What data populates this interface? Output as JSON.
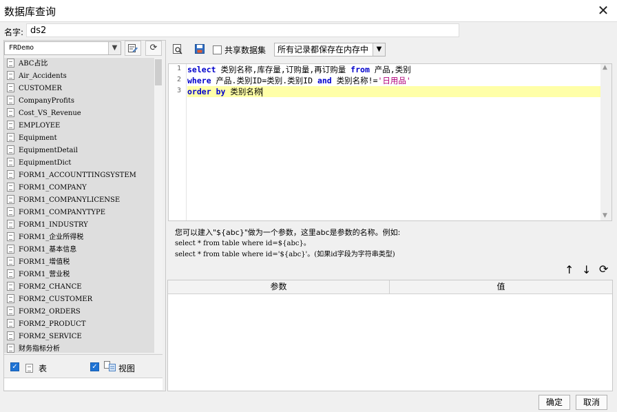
{
  "window": {
    "title": "数据库查询",
    "close_label": "✕"
  },
  "name_field": {
    "label": "名字:",
    "value": "ds2"
  },
  "left": {
    "datasource": "FRDemo",
    "tables": [
      "ABC占比",
      "Air_Accidents",
      "CUSTOMER",
      "CompanyProfits",
      "Cost_VS_Revenue",
      "EMPLOYEE",
      "Equipment",
      "EquipmentDetail",
      "EquipmentDict",
      "FORM1_ACCOUNTTINGSYSTEM",
      "FORM1_COMPANY",
      "FORM1_COMPANYLICENSE",
      "FORM1_COMPANYTYPE",
      "FORM1_INDUSTRY",
      "FORM1_企业所得税",
      "FORM1_基本信息",
      "FORM1_增值税",
      "FORM1_营业税",
      "FORM2_CHANCE",
      "FORM2_CUSTOMER",
      "FORM2_ORDERS",
      "FORM2_PRODUCT",
      "FORM2_SERVICE",
      "财务指标分析"
    ],
    "filter_table_label": "表",
    "filter_view_label": "视图"
  },
  "toolbar": {
    "share_label": "共享数据集",
    "memory_option": "所有记录都保存在内存中"
  },
  "editor": {
    "line_numbers": [
      "1",
      "2",
      "3"
    ],
    "line1": {
      "kw1": "select",
      "t1": " 类别名称,库存量,订购量,再订购量 ",
      "kw2": "from",
      "t2": " 产品,类别"
    },
    "line2": {
      "kw1": "where",
      "t1": " 产品.类别ID=类别.类别ID ",
      "kw2": "and",
      "t2": " 类别名称!=",
      "str": "'日用品'"
    },
    "line3": {
      "kw1": "order",
      "kw2": "by",
      "t1": " 类别名称"
    }
  },
  "hint": {
    "line1": "您可以建入\"${abc}\"做为一个参数，这里abc是参数的名称。例如:",
    "line2": "select * from table where id=${abc}。",
    "line3": "select * from table where id='${abc}'。(如果id字段为字符串类型)"
  },
  "params": {
    "col_param": "参数",
    "col_value": "值"
  },
  "buttons": {
    "ok": "确定",
    "cancel": "取消"
  }
}
